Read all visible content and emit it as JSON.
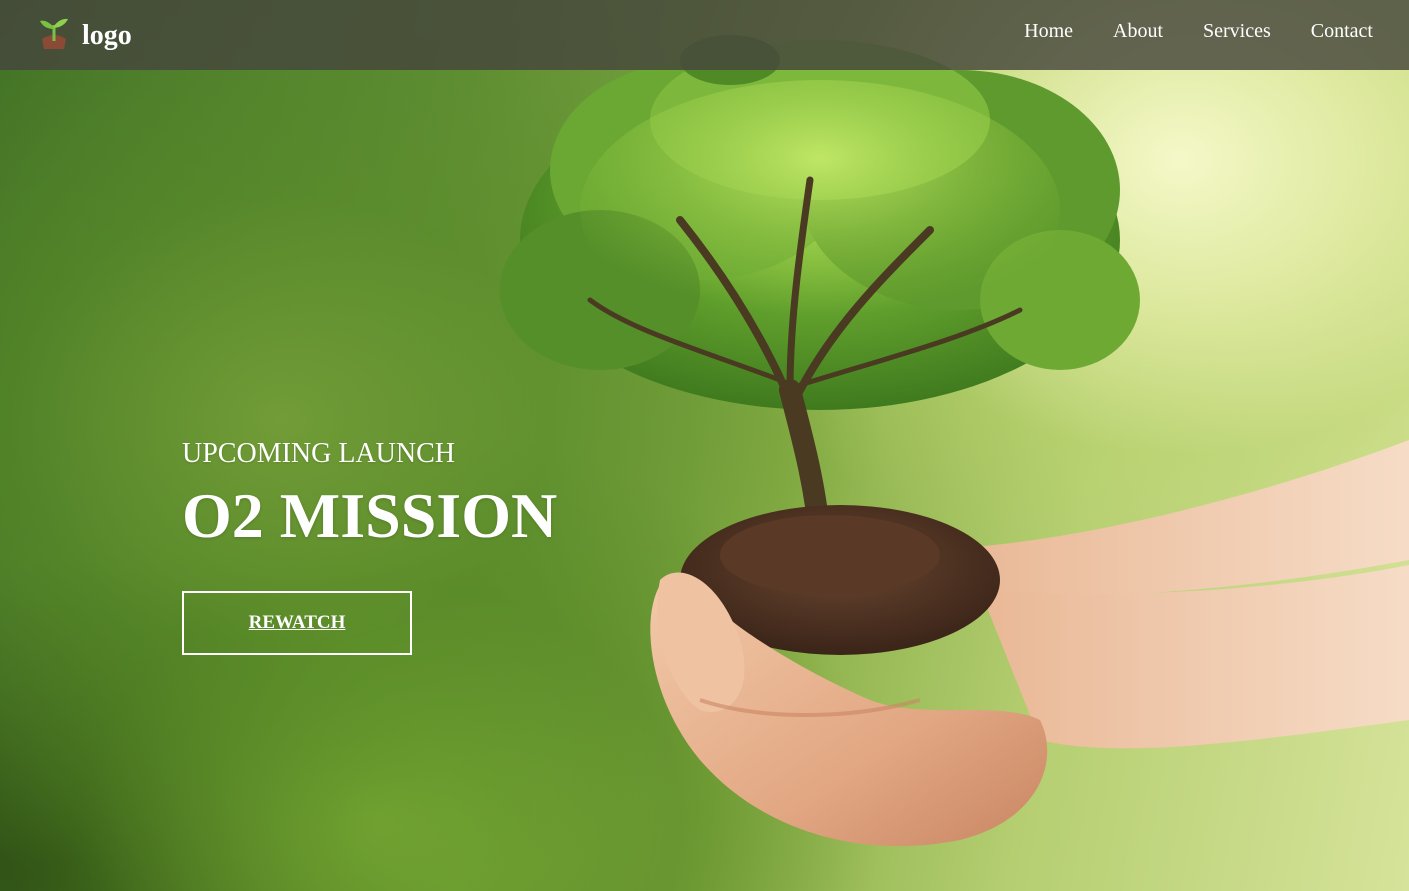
{
  "header": {
    "logo_text": "logo",
    "logo_icon": "sprout-icon",
    "nav": [
      {
        "label": "Home"
      },
      {
        "label": "About"
      },
      {
        "label": "Services"
      },
      {
        "label": "Contact"
      }
    ]
  },
  "hero": {
    "subtitle": "UPCOMING LAUNCH",
    "title": "O2 MISSION",
    "button_label": "REWATCH"
  },
  "colors": {
    "header_bg": "#46463c",
    "text": "#ffffff",
    "sprout_leaf": "#7ac143",
    "sprout_soil": "#a0522d"
  }
}
